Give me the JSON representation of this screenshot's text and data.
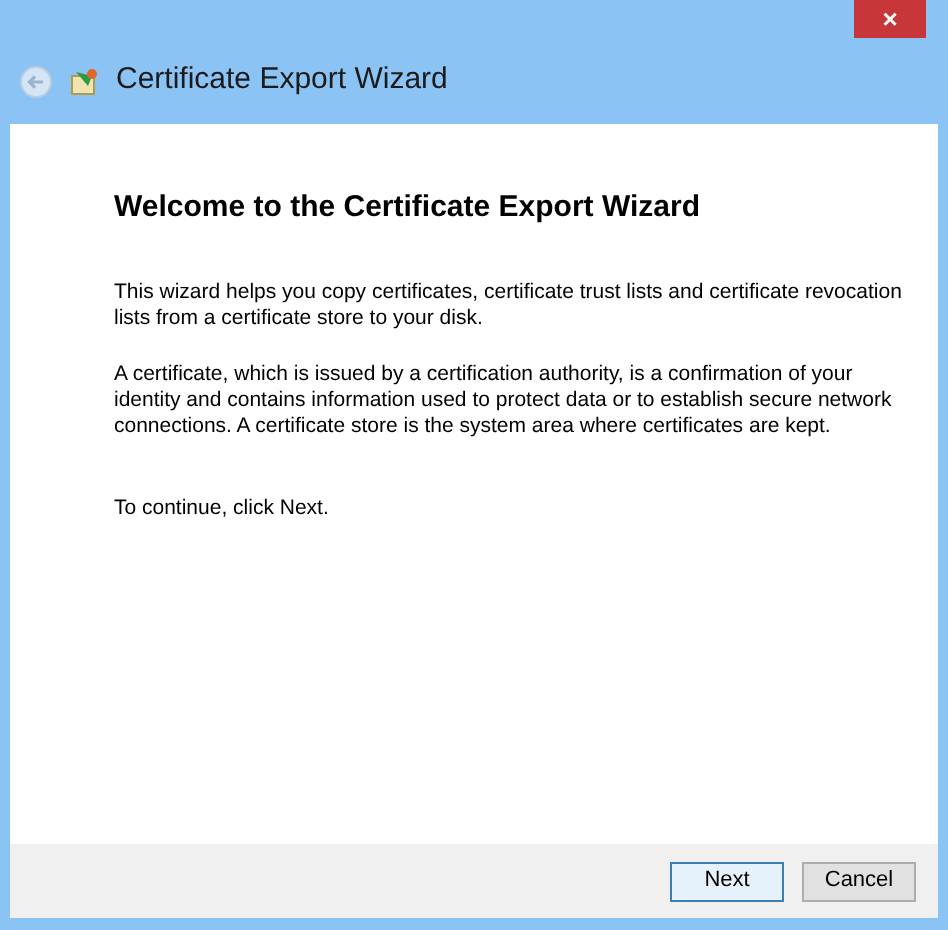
{
  "window": {
    "close": "×",
    "title": "Certificate Export Wizard"
  },
  "heading": "Welcome to the Certificate Export Wizard",
  "paragraphs": [
    "This wizard helps you copy certificates, certificate trust lists and certificate revocation lists from a certificate store to your disk.",
    "A certificate, which is issued by a certification authority, is a confirmation of your identity and contains information used to protect data or to establish secure network connections. A certificate store is the system area where certificates are kept.",
    "To continue, click Next."
  ],
  "buttons": [
    {
      "label": "Next",
      "default": true
    },
    {
      "label": "Cancel",
      "default": false
    }
  ]
}
